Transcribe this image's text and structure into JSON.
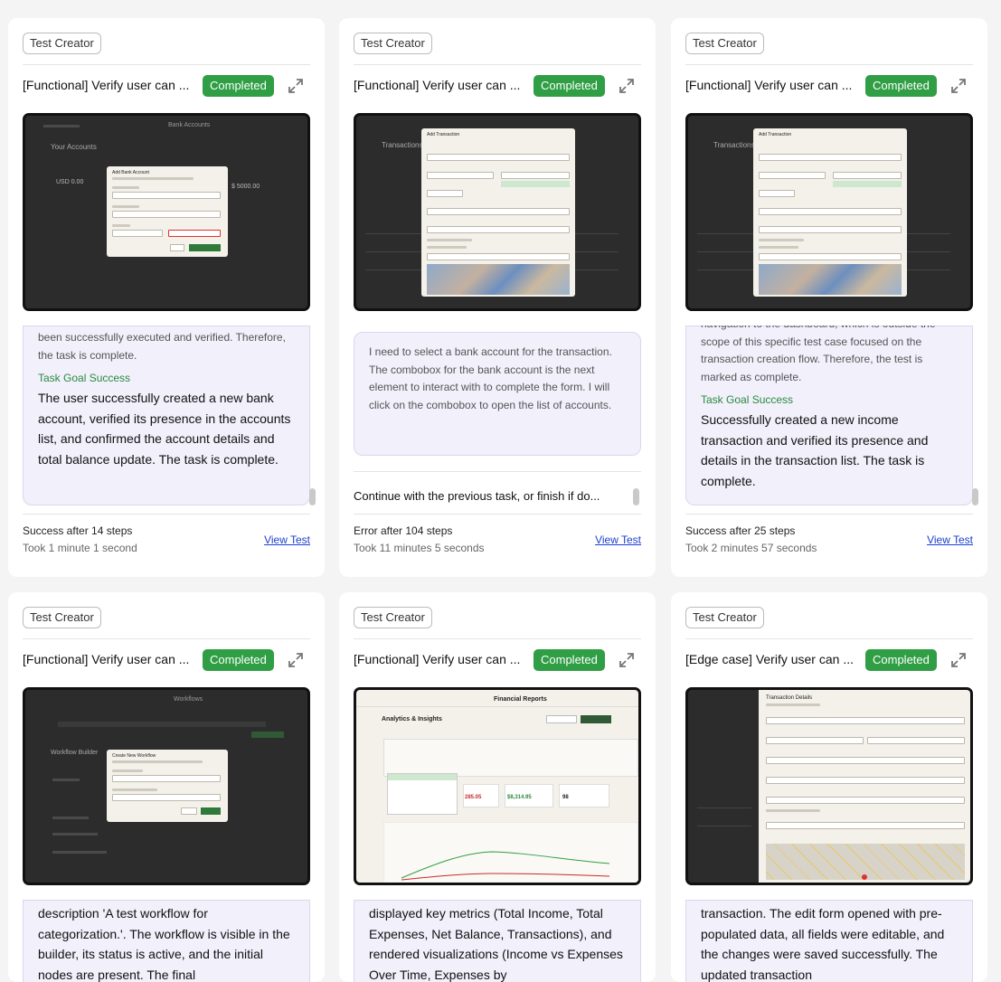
{
  "cards": [
    {
      "tag": "Test Creator",
      "title": "[Functional] Verify user can ...",
      "status": "Completed",
      "screenshot_heading": "Bank Accounts",
      "screenshot_modal_title": "Add Bank Account",
      "log_text": "been successfully executed and verified. Therefore, the task is complete.",
      "goal_heading": "Task Goal Success",
      "goal_text": "The user successfully created a new bank account, verified its presence in the accounts list, and confirmed the account details and total balance update. The task is complete.",
      "result": "Success after 14 steps",
      "duration": "Took 1 minute 1 second",
      "view_test": "View Test"
    },
    {
      "tag": "Test Creator",
      "title": "[Functional] Verify user can ...",
      "status": "Completed",
      "screenshot_heading": "Transactions",
      "screenshot_modal_title": "Add Transaction",
      "log_text": "I need to select a bank account for the transaction. The combobox for the bank account is the next element to interact with to complete the form. I will click on the combobox to open the list of accounts.",
      "continue_text": "Continue with the previous task, or finish if do...",
      "result": "Error after 104 steps",
      "duration": "Took 11 minutes 5 seconds",
      "view_test": "View Test"
    },
    {
      "tag": "Test Creator",
      "title": "[Functional] Verify user can ...",
      "status": "Completed",
      "screenshot_heading": "Transactions",
      "screenshot_modal_title": "Add Transaction",
      "log_text": "navigation to the dashboard, which is outside the scope of this specific test case focused on the transaction creation flow. Therefore, the test is marked as complete.",
      "goal_heading": "Task Goal Success",
      "goal_text": "Successfully created a new income transaction and verified its presence and details in the transaction list. The task is complete.",
      "result": "Success after 25 steps",
      "duration": "Took 2 minutes 57 seconds",
      "view_test": "View Test"
    },
    {
      "tag": "Test Creator",
      "title": "[Functional] Verify user can ...",
      "status": "Completed",
      "screenshot_heading": "Workflows",
      "screenshot_modal_title": "Create New Workflow",
      "log_text": "description 'A test workflow for categorization.'. The workflow is visible in the builder, its status is active, and the initial nodes are present. The final"
    },
    {
      "tag": "Test Creator",
      "title": "[Functional] Verify user can ...",
      "status": "Completed",
      "screenshot_heading": "Financial Reports",
      "screenshot_modal_title": "Analytics & Insights",
      "log_text": "displayed key metrics (Total Income, Total Expenses, Net Balance, Transactions), and rendered visualizations (Income vs Expenses Over Time, Expenses by"
    },
    {
      "tag": "Test Creator",
      "title": "[Edge case] Verify user can ...",
      "status": "Completed",
      "screenshot_heading": "Transaction Details",
      "screenshot_modal_title": "Transaction Details",
      "log_text": "transaction. The edit form opened with pre-populated data, all fields were editable, and the changes were saved successfully. The updated transaction"
    }
  ],
  "colors": {
    "accent": "#2f9e44",
    "link": "#1c3fcf",
    "bubble": "#f1f0fb"
  }
}
